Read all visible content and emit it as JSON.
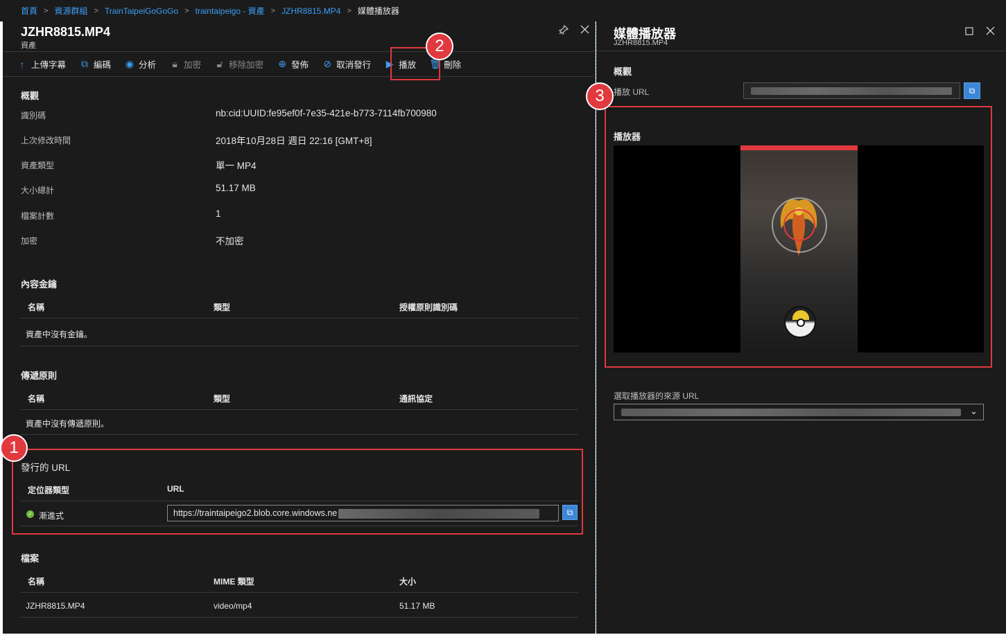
{
  "breadcrumb": [
    {
      "label": "首頁"
    },
    {
      "label": "資源群組"
    },
    {
      "label": "TrainTaipeiGoGoGo"
    },
    {
      "label": "traintaipeigo - 資產"
    },
    {
      "label": "JZHR8815.MP4"
    },
    {
      "label": "媒體播放器"
    }
  ],
  "left_blade": {
    "title": "JZHR8815.MP4",
    "subtitle": "資產",
    "pin_icon": "pin-icon",
    "close_icon": "close-icon"
  },
  "toolbar": [
    {
      "label": "上傳字幕",
      "icon": "upload-icon",
      "glyph": "↑",
      "disabled": false
    },
    {
      "label": "編碼",
      "icon": "encode-icon",
      "glyph": "⧉",
      "disabled": false
    },
    {
      "label": "分析",
      "icon": "eye-icon",
      "glyph": "◉",
      "disabled": false
    },
    {
      "label": "加密",
      "icon": "lock-icon",
      "glyph": "🔒︎",
      "disabled": true
    },
    {
      "label": "移除加密",
      "icon": "unlock-icon",
      "glyph": "🔓︎",
      "disabled": true
    },
    {
      "label": "發佈",
      "icon": "globe-icon",
      "glyph": "⊕",
      "disabled": false
    },
    {
      "label": "取消發行",
      "icon": "cancel-icon",
      "glyph": "⊘",
      "disabled": false
    },
    {
      "label": "播放",
      "icon": "play-icon",
      "glyph": "▶",
      "disabled": false
    },
    {
      "label": "刪除",
      "icon": "trash-icon",
      "glyph": "🗑︎",
      "disabled": false
    }
  ],
  "overview": {
    "title": "概觀",
    "rows": [
      {
        "key": "識別碼",
        "value": "nb:cid:UUID:fe95ef0f-7e35-421e-b773-7114fb700980"
      },
      {
        "key": "上次修改時間",
        "value": "2018年10月28日 週日 22:16 [GMT+8]"
      },
      {
        "key": "資產類型",
        "value": "單一 MP4"
      },
      {
        "key": "大小總計",
        "value": "51.17 MB"
      },
      {
        "key": "檔案計數",
        "value": "1"
      },
      {
        "key": "加密",
        "value": "不加密"
      }
    ]
  },
  "content_keys": {
    "title": "內容金鑰",
    "headers": [
      "名稱",
      "類型",
      "授權原則識別碼"
    ],
    "empty": "資產中沒有金鑰。"
  },
  "delivery_policy": {
    "title": "傳遞原則",
    "headers": [
      "名稱",
      "類型",
      "通訊協定"
    ],
    "empty": "資產中沒有傳遞原則。"
  },
  "published_urls": {
    "title": "發行的 URL",
    "headers": [
      "定位器類型",
      "URL"
    ],
    "row": {
      "type": "漸進式",
      "url": "https://traintaipeigo2.blob.core.windows.ne"
    }
  },
  "files": {
    "title": "檔案",
    "headers": [
      "名稱",
      "MIME 類型",
      "大小"
    ],
    "rows": [
      [
        "JZHR8815.MP4",
        "video/mp4",
        "51.17 MB"
      ]
    ]
  },
  "right_blade": {
    "title": "媒體播放器",
    "subtitle": "JZHR8815.MP4",
    "overview_title": "概觀",
    "play_url_label": "播放 URL",
    "player_title": "播放器",
    "source_label": "選取播放器的來源 URL"
  },
  "annotations": [
    "1",
    "2",
    "3"
  ],
  "colors": {
    "accent": "#3c9df5",
    "highlight": "#e0393e",
    "background": "#1b1b1b",
    "success": "#6fba3a"
  }
}
